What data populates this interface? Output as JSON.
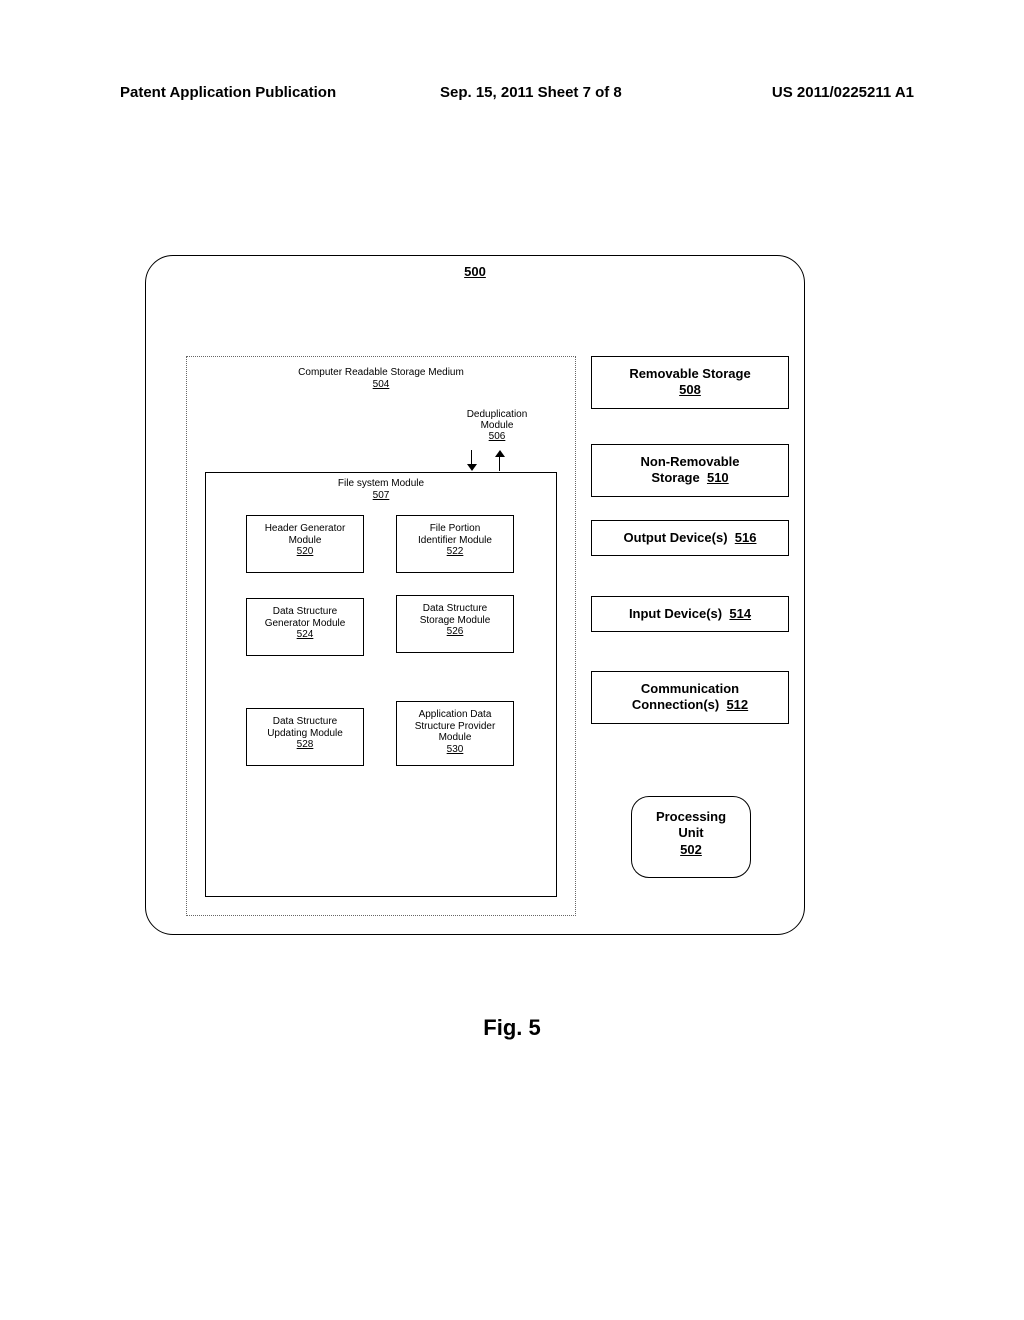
{
  "header": {
    "left": "Patent Application Publication",
    "mid": "Sep. 15, 2011  Sheet 7 of 8",
    "right": "US 2011/0225211 A1"
  },
  "figure_label": "Fig. 5",
  "outer_ref": "500",
  "storage_medium": {
    "title": "Computer Readable Storage Medium",
    "ref": "504"
  },
  "deduplication": {
    "line1": "Deduplication",
    "line2": "Module",
    "ref": "506"
  },
  "file_system": {
    "title": "File system Module",
    "ref": "507"
  },
  "modules": {
    "header_gen": {
      "l1": "Header Generator",
      "l2": "Module",
      "ref": "520"
    },
    "file_portion": {
      "l1": "File Portion",
      "l2": "Identifier Module",
      "ref": "522"
    },
    "ds_generator": {
      "l1": "Data Structure",
      "l2": "Generator Module",
      "ref": "524"
    },
    "ds_storage": {
      "l1": "Data Structure",
      "l2": "Storage Module",
      "ref": "526"
    },
    "ds_updating": {
      "l1": "Data Structure",
      "l2": "Updating Module",
      "ref": "528"
    },
    "app_provider": {
      "l1": "Application Data",
      "l2": "Structure Provider",
      "l3": "Module",
      "ref": "530"
    }
  },
  "right_blocks": {
    "removable": {
      "title": "Removable Storage",
      "ref": "508"
    },
    "nonremovable": {
      "l1": "Non-Removable",
      "l2": "Storage",
      "ref": "510"
    },
    "output": {
      "title": "Output Device(s)",
      "ref": "516"
    },
    "input": {
      "title": "Input Device(s)",
      "ref": "514"
    },
    "comm": {
      "l1": "Communication",
      "l2": "Connection(s)",
      "ref": "512"
    }
  },
  "processing": {
    "l1": "Processing",
    "l2": "Unit",
    "ref": "502"
  }
}
